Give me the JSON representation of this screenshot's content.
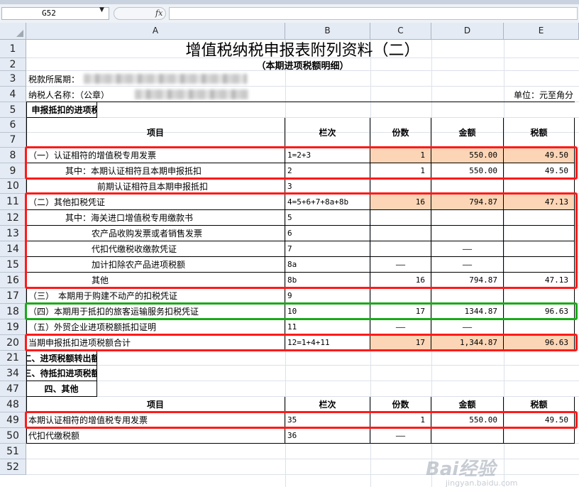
{
  "app": {
    "name_box": "G52",
    "fx_label": "fx",
    "formula": ""
  },
  "columns": [
    "A",
    "B",
    "C",
    "D",
    "E"
  ],
  "rows": [
    "1",
    "2",
    "3",
    "4",
    "5",
    "6",
    "7",
    "8",
    "9",
    "10",
    "11",
    "12",
    "13",
    "14",
    "15",
    "16",
    "17",
    "18",
    "19",
    "20",
    "21",
    "34",
    "47",
    "48",
    "49",
    "50",
    "51",
    "52"
  ],
  "sheet": {
    "title": "增值税纳税申报表附列资料（二）",
    "subtitle": "（本期进项税额明细）",
    "period_label": "税款所属期：",
    "taxpayer_label": "纳税人名称：（公章）",
    "unit_label": "单位：元至角分",
    "section1": "一、申报抵扣的进项税额",
    "section2": "二、进项税额转出额",
    "section3": "三、待抵扣进项税额",
    "section4": "四、其他",
    "headers": {
      "item": "项目",
      "line": "栏次",
      "count": "份数",
      "amount": "金额",
      "tax": "税额"
    },
    "headers2": {
      "item": "项目",
      "line": "栏次",
      "count": "份数",
      "amount": "金额",
      "tax": "税额"
    },
    "r8": {
      "item": "（一）认证相符的增值税专用发票",
      "line": "1=2+3",
      "count": "1",
      "amount": "550.00",
      "tax": "49.50"
    },
    "r9": {
      "item": "其中：本期认证相符且本期申报抵扣",
      "line": "2",
      "count": "1",
      "amount": "550.00",
      "tax": "49.50"
    },
    "r10": {
      "item": "前期认证相符且本期申报抵扣",
      "line": "3"
    },
    "r11": {
      "item": "（二）其他扣税凭证",
      "line": "4=5+6+7+8a+8b",
      "count": "16",
      "amount": "794.87",
      "tax": "47.13"
    },
    "r12": {
      "item": "其中：海关进口增值税专用缴款书",
      "line": "5"
    },
    "r13": {
      "item": "农产品收购发票或者销售发票",
      "line": "6"
    },
    "r14": {
      "item": "代扣代缴税收缴款凭证",
      "line": "7",
      "amount": "——"
    },
    "r15": {
      "item": "加计扣除农产品进项税额",
      "line": "8a",
      "count": "——",
      "amount": "——"
    },
    "r16": {
      "item": "其他",
      "line": "8b",
      "count": "16",
      "amount": "794.87",
      "tax": "47.13"
    },
    "r17": {
      "item": "（三）　本期用于购建不动产的扣税凭证",
      "line": "9"
    },
    "r18": {
      "item": "（四）本期用于抵扣的旅客运输服务扣税凭证",
      "line": "10",
      "count": "17",
      "amount": "1344.87",
      "tax": "96.63"
    },
    "r19": {
      "item": "（五）外贸企业进项税额抵扣证明",
      "line": "11",
      "count": "——",
      "amount": "——"
    },
    "r20": {
      "item": "当期申报抵扣进项税额合计",
      "line": "12=1+4+11",
      "count": "17",
      "amount": "1,344.87",
      "tax": "96.63"
    },
    "r49": {
      "item": "本期认证相符的增值税专用发票",
      "line": "35",
      "count": "1",
      "amount": "550.00",
      "tax": "49.50"
    },
    "r50": {
      "item": "代扣代缴税额",
      "line": "36",
      "count": "——"
    }
  },
  "colors": {
    "peach": "#fbd5b5",
    "highlight_red": "#ff1a1a",
    "highlight_green": "#1aaa1a"
  },
  "watermark": {
    "text": "Bai经验",
    "sub": "jingyan.baidu.com"
  }
}
